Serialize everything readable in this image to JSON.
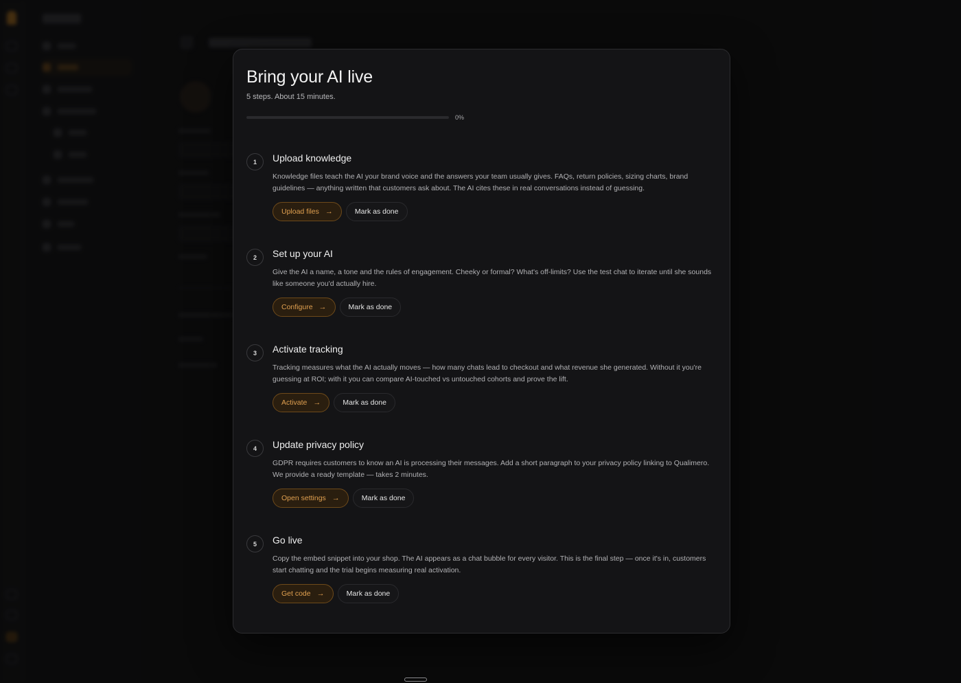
{
  "colors": {
    "accent": "#e0a050",
    "background": "#0d0d0e",
    "modal": "#141416"
  },
  "modal": {
    "title": "Bring your AI live",
    "subtitle": "5 steps. About 15 minutes.",
    "progress_percent": 0,
    "progress_label": "0%"
  },
  "steps": [
    {
      "number": "1",
      "title": "Upload knowledge",
      "description": "Knowledge files teach the AI your brand voice and the answers your team usually gives. FAQs, return policies, sizing charts, brand guidelines — anything written that customers ask about. The AI cites these in real conversations instead of guessing.",
      "primary_label": "Upload files",
      "secondary_label": "Mark as done"
    },
    {
      "number": "2",
      "title": "Set up your AI",
      "description": "Give the AI a name, a tone and the rules of engagement. Cheeky or formal? What's off-limits? Use the test chat to iterate until she sounds like someone you'd actually hire.",
      "primary_label": "Configure",
      "secondary_label": "Mark as done"
    },
    {
      "number": "3",
      "title": "Activate tracking",
      "description": "Tracking measures what the AI actually moves — how many chats lead to checkout and what revenue she generated. Without it you're guessing at ROI; with it you can compare AI-touched vs untouched cohorts and prove the lift.",
      "primary_label": "Activate",
      "secondary_label": "Mark as done"
    },
    {
      "number": "4",
      "title": "Update privacy policy",
      "description": "GDPR requires customers to know an AI is processing their messages. Add a short paragraph to your privacy policy linking to Qualimero. We provide a ready template — takes 2 minutes.",
      "primary_label": "Open settings",
      "secondary_label": "Mark as done"
    },
    {
      "number": "5",
      "title": "Go live",
      "description": "Copy the embed snippet into your shop. The AI appears as a chat bubble for every visitor. This is the final step — once it's in, customers start chatting and the trial begins measuring real activation.",
      "primary_label": "Get code",
      "secondary_label": "Mark as done"
    }
  ]
}
